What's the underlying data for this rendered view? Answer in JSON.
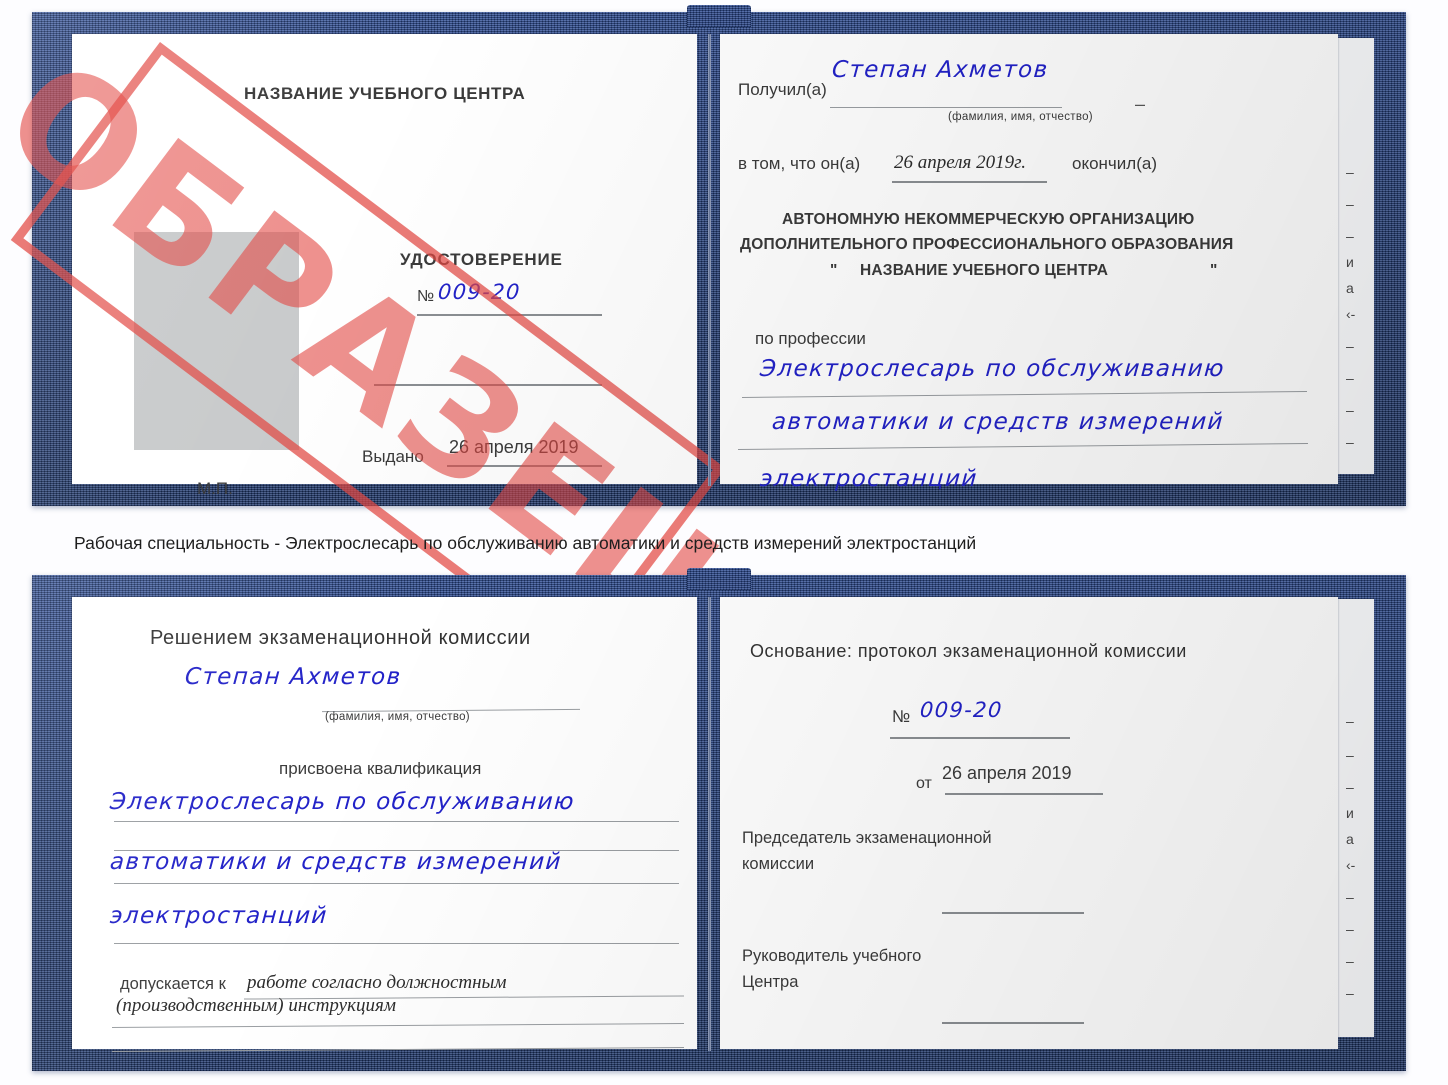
{
  "caption": {
    "text": "Рабочая специальность - Электрослесарь по обслуживанию автоматики и средств измерений электростанций"
  },
  "stamp": {
    "label": "ОБРАЗЕЦ",
    "color": "#E24842"
  },
  "certificate_top": {
    "left_page": {
      "header": "НАЗВАНИЕ УЧЕБНОГО ЦЕНТРА",
      "doc_type": "УДОСТОВЕРЕНИЕ",
      "number_label": "№",
      "number_value": "009-20",
      "issued_label": "Выдано",
      "issued_value": "26 апреля 2019",
      "seal_label": "М.П.",
      "photo_placeholder": "photo-placeholder"
    },
    "right_page": {
      "received_label": "Получил(а)",
      "received_value": "Степан Ахметов",
      "name_hint": "(фамилия, имя, отчество)",
      "in_that_label": "в том, что он(а)",
      "completion_date": "26 апреля 2019г.",
      "finished_label": "окончил(а)",
      "org_line1": "АВТОНОМНУЮ НЕКОММЕРЧЕСКУЮ ОРГАНИЗАЦИЮ",
      "org_line2": "ДОПОЛНИТЕЛЬНОГО ПРОФЕССИОНАЛЬНОГО ОБРАЗОВАНИЯ",
      "org_quote_open": "\"",
      "org_line3": "НАЗВАНИЕ УЧЕБНОГО ЦЕНТРА",
      "org_quote_close": "\"",
      "profession_label": "по профессии",
      "profession_line1": "Электрослесарь по обслуживанию",
      "profession_line2": "автоматики и средств измерений",
      "profession_line3": "электростанций",
      "margin_scraps": [
        "–",
        "–",
        "–",
        "и",
        "а",
        "‹-",
        "–",
        "–",
        "–",
        "–"
      ]
    }
  },
  "certificate_bottom": {
    "left_page": {
      "header": "Решением экзаменационной комиссии",
      "name_value": "Степан Ахметов",
      "name_hint": "(фамилия, имя, отчество)",
      "qualification_label": "присвоена квалификация",
      "qualification_line1": "Электрослесарь по обслуживанию",
      "qualification_line2": "автоматики и средств измерений",
      "qualification_line3": "электростанций",
      "allowed_label": "допускается к",
      "allowed_line1": "работе согласно должностным",
      "allowed_line2": "(производственным) инструкциям"
    },
    "right_page": {
      "basis_label": "Основание: протокол экзаменационной комиссии",
      "number_label": "№",
      "number_value": "009-20",
      "date_label": "от",
      "date_value": "26 апреля 2019",
      "chairman_line1": "Председатель экзаменационной",
      "chairman_line2": "комиссии",
      "head_line1": "Руководитель учебного",
      "head_line2": "Центра",
      "margin_scraps": [
        "–",
        "–",
        "–",
        "и",
        "а",
        "‹-",
        "–",
        "–",
        "–",
        "–"
      ]
    }
  }
}
